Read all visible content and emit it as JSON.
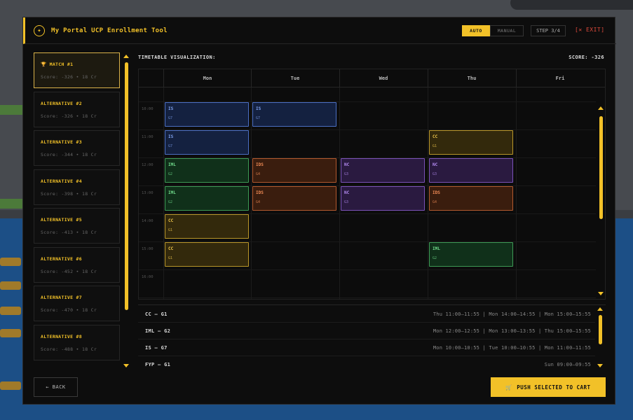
{
  "header": {
    "title": "My Portal UCP Enrollment Tool",
    "logo_icon": "trophy-logo",
    "mode_auto": "AUTO",
    "mode_manual": "MANUAL",
    "step": "STEP 3/4",
    "exit": "[✕ EXIT]"
  },
  "sidebar": {
    "items": [
      {
        "title": "🏆 MATCH #1",
        "score": "Score: -326 • 18 Cr",
        "active": true
      },
      {
        "title": "ALTERNATIVE #2",
        "score": "Score: -326 • 18 Cr"
      },
      {
        "title": "ALTERNATIVE #3",
        "score": "Score: -344 • 18 Cr"
      },
      {
        "title": "ALTERNATIVE #4",
        "score": "Score: -398 • 18 Cr"
      },
      {
        "title": "ALTERNATIVE #5",
        "score": "Score: -413 • 18 Cr"
      },
      {
        "title": "ALTERNATIVE #6",
        "score": "Score: -452 • 18 Cr"
      },
      {
        "title": "ALTERNATIVE #7",
        "score": "Score: -470 • 18 Cr"
      },
      {
        "title": "ALTERNATIVE #8",
        "score": "Score: -488 • 18 Cr"
      }
    ]
  },
  "timetable": {
    "label": "TIMETABLE VISUALIZATION:",
    "score": "SCORE: -326",
    "days": [
      "Mon",
      "Tue",
      "Wed",
      "Thu",
      "Fri"
    ],
    "times": [
      "10:00",
      "11:00",
      "12:00",
      "13:00",
      "14:00",
      "15:00",
      "16:00"
    ],
    "slots": [
      {
        "day": 0,
        "row": 0,
        "course": "IS",
        "group": "G7",
        "kind": "blue"
      },
      {
        "day": 1,
        "row": 0,
        "course": "IS",
        "group": "G7",
        "kind": "blue"
      },
      {
        "day": 0,
        "row": 1,
        "course": "IS",
        "group": "G7",
        "kind": "blue"
      },
      {
        "day": 3,
        "row": 1,
        "course": "CC",
        "group": "G1",
        "kind": "yellow"
      },
      {
        "day": 0,
        "row": 2,
        "course": "IML",
        "group": "G2",
        "kind": "green"
      },
      {
        "day": 1,
        "row": 2,
        "course": "IDS",
        "group": "G4",
        "kind": "orange"
      },
      {
        "day": 2,
        "row": 2,
        "course": "NC",
        "group": "G3",
        "kind": "purple"
      },
      {
        "day": 3,
        "row": 2,
        "course": "NC",
        "group": "G3",
        "kind": "purple"
      },
      {
        "day": 0,
        "row": 3,
        "course": "IML",
        "group": "G2",
        "kind": "green"
      },
      {
        "day": 1,
        "row": 3,
        "course": "IDS",
        "group": "G4",
        "kind": "orange"
      },
      {
        "day": 2,
        "row": 3,
        "course": "NC",
        "group": "G3",
        "kind": "purple"
      },
      {
        "day": 3,
        "row": 3,
        "course": "IDS",
        "group": "G4",
        "kind": "orange"
      },
      {
        "day": 0,
        "row": 4,
        "course": "CC",
        "group": "G1",
        "kind": "yellow"
      },
      {
        "day": 0,
        "row": 5,
        "course": "CC",
        "group": "G1",
        "kind": "yellow"
      },
      {
        "day": 3,
        "row": 5,
        "course": "IML",
        "group": "G2",
        "kind": "green"
      }
    ],
    "colors": {
      "blue": {
        "bg": "#142140",
        "border": "#4b6fc4",
        "text": "#7ea1ee"
      },
      "green": {
        "bg": "#10301a",
        "border": "#3d9a55",
        "text": "#6fd889"
      },
      "orange": {
        "bg": "#3a1d0e",
        "border": "#b25a2e",
        "text": "#ef8a55"
      },
      "purple": {
        "bg": "#2a1a40",
        "border": "#7b52b8",
        "text": "#b38af0"
      },
      "yellow": {
        "bg": "#33290c",
        "border": "#b99629",
        "text": "#f2c94c"
      }
    }
  },
  "courses": [
    {
      "name": "CC — G1",
      "times": "Thu 11:00–11:55 | Mon 14:00–14:55 | Mon 15:00–15:55"
    },
    {
      "name": "IML — G2",
      "times": "Mon 12:00–12:55 | Mon 13:00–13:55 | Thu 15:00–15:55"
    },
    {
      "name": "IS — G7",
      "times": "Mon 10:00–10:55 | Tue 10:00–10:55 | Mon 11:00–11:55"
    },
    {
      "name": "FYP — G1",
      "times": "Sun 09:00–09:55"
    }
  ],
  "footer": {
    "back": "← BACK",
    "cart": "PUSH SELECTED TO CART",
    "cart_icon": "cart-icon"
  }
}
